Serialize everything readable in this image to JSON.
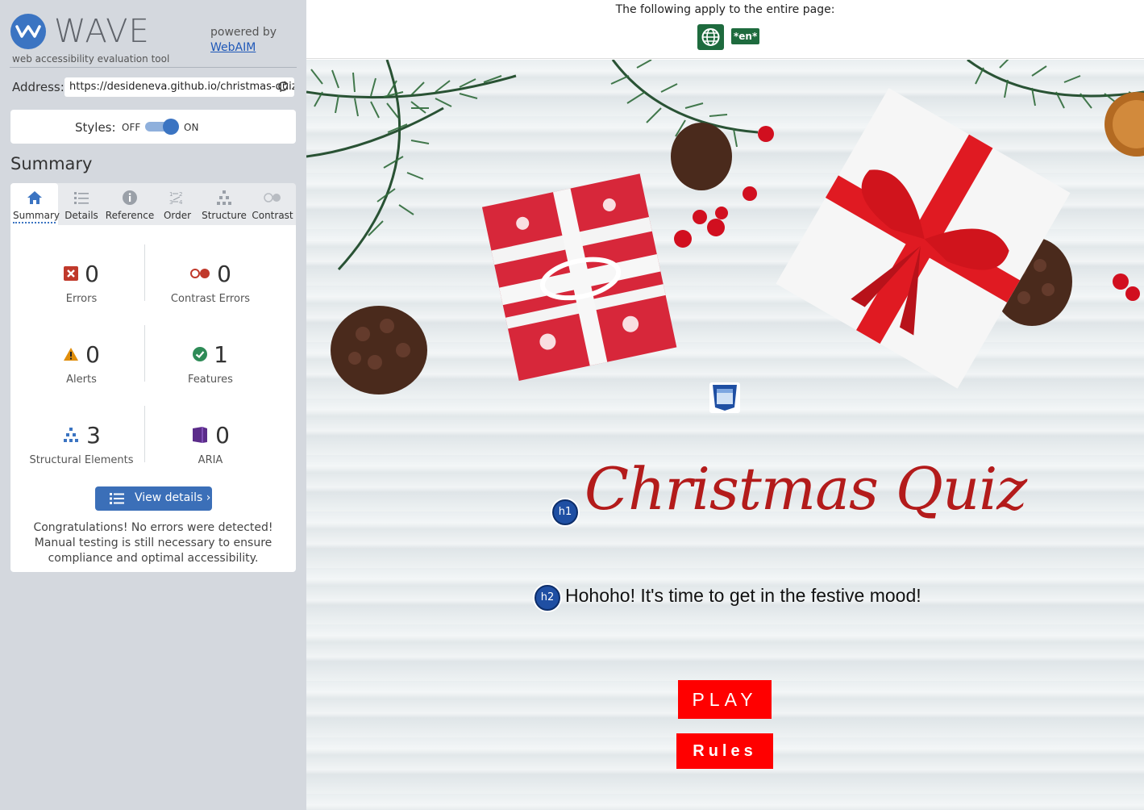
{
  "wave": {
    "brand": "WAVE",
    "tagline": "web accessibility evaluation tool",
    "powered_by": "powered by",
    "webaim_link": "WebAIM",
    "address_label": "Address:",
    "address_value": "https://desideneva.github.io/christmas-quiz",
    "styles_label": "Styles:",
    "styles_off": "OFF",
    "styles_on": "ON",
    "styles_state": "on",
    "summary_title": "Summary",
    "tabs": [
      {
        "label": "Summary",
        "icon": "home-icon",
        "active": true
      },
      {
        "label": "Details",
        "icon": "list-icon",
        "active": false
      },
      {
        "label": "Reference",
        "icon": "info-icon",
        "active": false
      },
      {
        "label": "Order",
        "icon": "order-icon",
        "active": false
      },
      {
        "label": "Structure",
        "icon": "structure-icon",
        "active": false
      },
      {
        "label": "Contrast",
        "icon": "contrast-icon",
        "active": false
      }
    ],
    "stats": {
      "errors": {
        "count": "0",
        "label": "Errors",
        "color": "#c0392b"
      },
      "contrast_errors": {
        "count": "0",
        "label": "Contrast Errors",
        "color": "#c0392b"
      },
      "alerts": {
        "count": "0",
        "label": "Alerts",
        "color": "#e08e0b"
      },
      "features": {
        "count": "1",
        "label": "Features",
        "color": "#2e8b57"
      },
      "structural": {
        "count": "3",
        "label": "Structural Elements",
        "color": "#3b74c2"
      },
      "aria": {
        "count": "0",
        "label": "ARIA",
        "color": "#5b2c8a"
      }
    },
    "view_details": "View details ›",
    "congrats": "Congratulations! No errors were detected! Manual testing is still necessary to ensure compliance and optimal accessibility."
  },
  "page_bar": {
    "text": "The following apply to the entire page:",
    "lang_badge": "*en*"
  },
  "site": {
    "h1_badge": "h1",
    "title": "Christmas Quiz",
    "h2_badge": "h2",
    "subtitle": "Hohoho! It's time to get in the festive mood!",
    "play_button": "PLAY",
    "rules_button": "Rules"
  },
  "colors": {
    "wave_blue": "#3b74c2",
    "sidebar_bg": "#d4d8de",
    "button_red": "#ff0000",
    "title_red": "#b31b1b",
    "badge_green": "#1e6b3e"
  }
}
